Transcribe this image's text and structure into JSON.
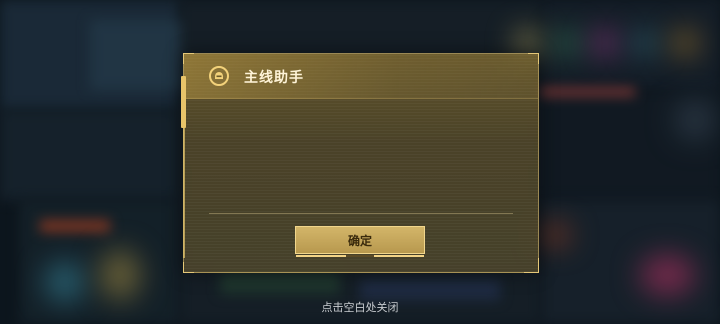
{
  "dialog": {
    "title": "主线助手",
    "confirm_label": "确定",
    "icon": "helmet-icon"
  },
  "close_hint": "点击空白处关闭",
  "colors": {
    "accent": "#e8c46a",
    "panel": "#7a6a36",
    "title_text": "#fff4d8",
    "button_text": "#3a2a0c"
  }
}
